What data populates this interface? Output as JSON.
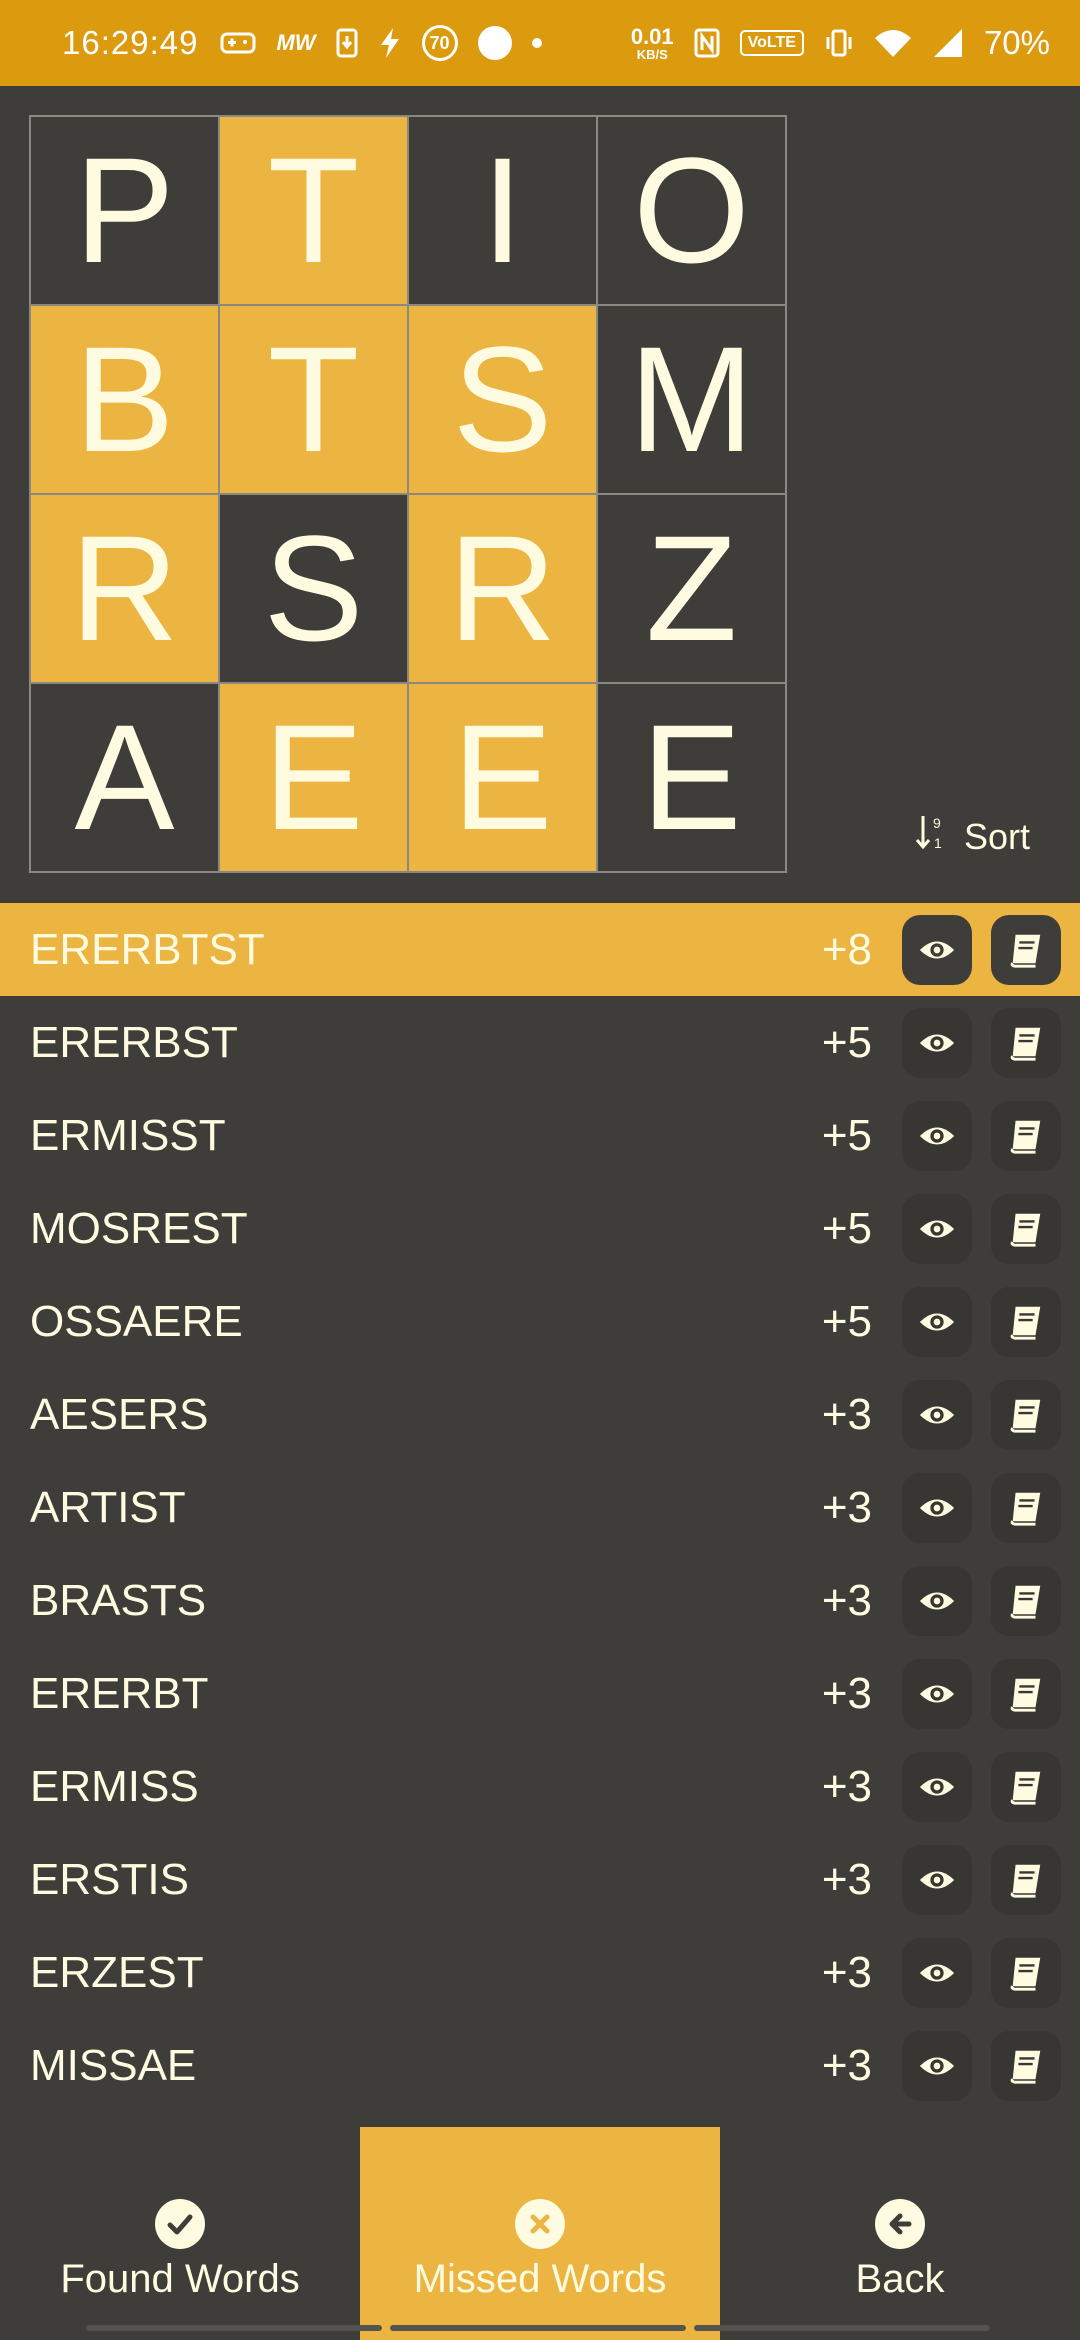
{
  "status_bar": {
    "time": "16:29:49",
    "speed_value": "0.01",
    "speed_unit": "KB/S",
    "badge_number": "70",
    "volte": "VoLTE",
    "battery": "70%"
  },
  "grid": {
    "cells": [
      {
        "letter": "P",
        "highlighted": false
      },
      {
        "letter": "T",
        "highlighted": true
      },
      {
        "letter": "I",
        "highlighted": false
      },
      {
        "letter": "O",
        "highlighted": false
      },
      {
        "letter": "B",
        "highlighted": true
      },
      {
        "letter": "T",
        "highlighted": true
      },
      {
        "letter": "S",
        "highlighted": true
      },
      {
        "letter": "M",
        "highlighted": false
      },
      {
        "letter": "R",
        "highlighted": true
      },
      {
        "letter": "S",
        "highlighted": false
      },
      {
        "letter": "R",
        "highlighted": true
      },
      {
        "letter": "Z",
        "highlighted": false
      },
      {
        "letter": "A",
        "highlighted": false
      },
      {
        "letter": "E",
        "highlighted": true
      },
      {
        "letter": "E",
        "highlighted": true
      },
      {
        "letter": "E",
        "highlighted": false
      }
    ]
  },
  "sort": {
    "label": "Sort",
    "icon": "sort-numeric-icon"
  },
  "words": [
    {
      "word": "ERERBTST",
      "points": "+8",
      "active": true
    },
    {
      "word": "ERERBST",
      "points": "+5"
    },
    {
      "word": "ERMISST",
      "points": "+5"
    },
    {
      "word": "MOSREST",
      "points": "+5"
    },
    {
      "word": "OSSAERE",
      "points": "+5"
    },
    {
      "word": "AESERS",
      "points": "+3"
    },
    {
      "word": "ARTIST",
      "points": "+3"
    },
    {
      "word": "BRASTS",
      "points": "+3"
    },
    {
      "word": "ERERBT",
      "points": "+3"
    },
    {
      "word": "ERMISS",
      "points": "+3"
    },
    {
      "word": "ERSTIS",
      "points": "+3"
    },
    {
      "word": "ERZEST",
      "points": "+3"
    },
    {
      "word": "MISSAE",
      "points": "+3"
    }
  ],
  "bottom_nav": {
    "found": {
      "label": "Found Words",
      "icon": "check-circle-icon"
    },
    "missed": {
      "label": "Missed Words",
      "icon": "x-circle-icon",
      "active": true
    },
    "back": {
      "label": "Back",
      "icon": "arrow-left-circle-icon"
    }
  },
  "colors": {
    "accent": "#ecb440",
    "status_bar": "#dc9a0e",
    "background": "#3e3d3a",
    "text": "#fffbe0"
  }
}
